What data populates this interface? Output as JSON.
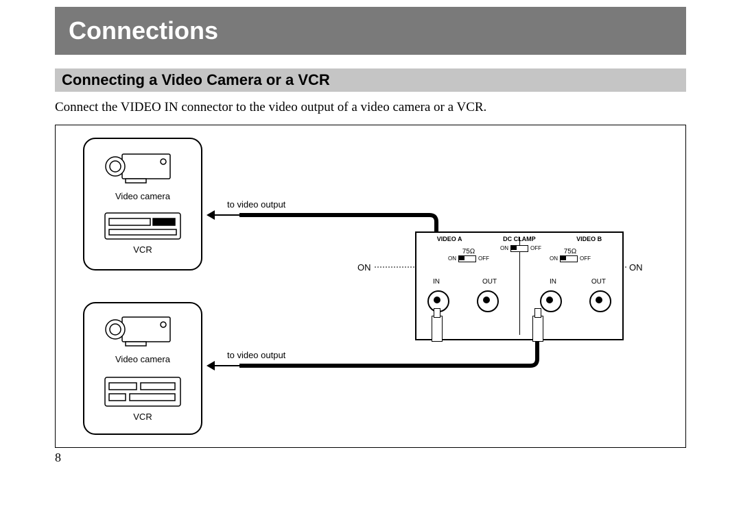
{
  "title": "Connections",
  "subtitle": "Connecting a Video Camera or a VCR",
  "instruction": "Connect the VIDEO IN connector to the video output of a video camera or a VCR.",
  "pageNumber": "8",
  "diagram": {
    "source": {
      "camLabel": "Video camera",
      "vcrLabel": "VCR"
    },
    "cable": {
      "toVideoOutput": "to video output"
    },
    "on": "ON",
    "panel": {
      "videoA": "VIDEO A",
      "dcClamp": "DC CLAMP",
      "videoB": "VIDEO B",
      "onSmall": "ON",
      "offSmall": "OFF",
      "ohm": "75Ω",
      "in": "IN",
      "out": "OUT"
    }
  }
}
